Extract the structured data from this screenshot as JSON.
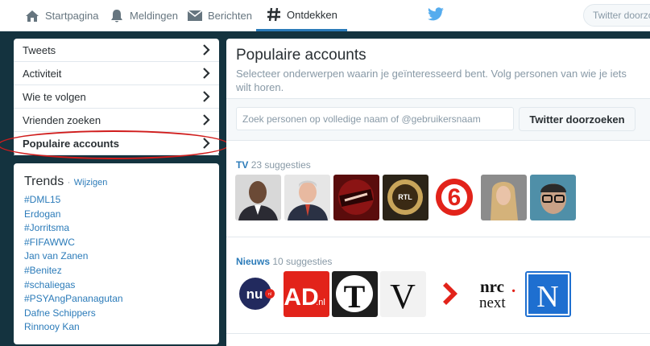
{
  "nav": {
    "items": [
      {
        "label": "Startpagina",
        "icon": "home-icon"
      },
      {
        "label": "Meldingen",
        "icon": "bell-icon"
      },
      {
        "label": "Berichten",
        "icon": "envelope-icon"
      },
      {
        "label": "Ontdekken",
        "icon": "hashtag-icon"
      }
    ],
    "search_placeholder": "Twitter doorzoeken"
  },
  "menu": {
    "items": [
      {
        "label": "Tweets"
      },
      {
        "label": "Activiteit"
      },
      {
        "label": "Wie te volgen"
      },
      {
        "label": "Vrienden zoeken"
      },
      {
        "label": "Populaire accounts"
      }
    ]
  },
  "trends": {
    "title": "Trends",
    "separator": "·",
    "change_label": "Wijzigen",
    "items": [
      "#DML15",
      "Erdogan",
      "#Jorritsma",
      "#FIFAWWC",
      "Jan van Zanen",
      "#Benitez",
      "#schaliegas",
      "#PSYAngPananagutan",
      "Dafne Schippers",
      "Rinnooy Kan"
    ]
  },
  "main": {
    "title": "Populaire accounts",
    "subtitle": "Selecteer onderwerpen waarin je geïnteresseerd bent. Volg personen van wie je iets wilt horen.",
    "people_search_placeholder": "Zoek personen op volledige naam of @gebruikersnaam",
    "search_button": "Twitter doorzoeken",
    "sections": [
      {
        "category": "TV",
        "count_label": "23 suggesties"
      },
      {
        "category": "Nieuws",
        "count_label": "10 suggesties"
      }
    ]
  },
  "news_logos": {
    "nu": "nu",
    "nl": "nl",
    "ad": "AD",
    "adnl": ".nl",
    "telegraaf": "T",
    "volkskrant": "V",
    "nrc_top": "nrc",
    "nrc_dot": ".",
    "nrc_bottom": "next",
    "nos": "N",
    "rtl": "RTL",
    "sbs": "6"
  },
  "colors": {
    "accent": "#2b7bb9",
    "background": "#14333f",
    "highlight_ring": "#d01c1c"
  }
}
